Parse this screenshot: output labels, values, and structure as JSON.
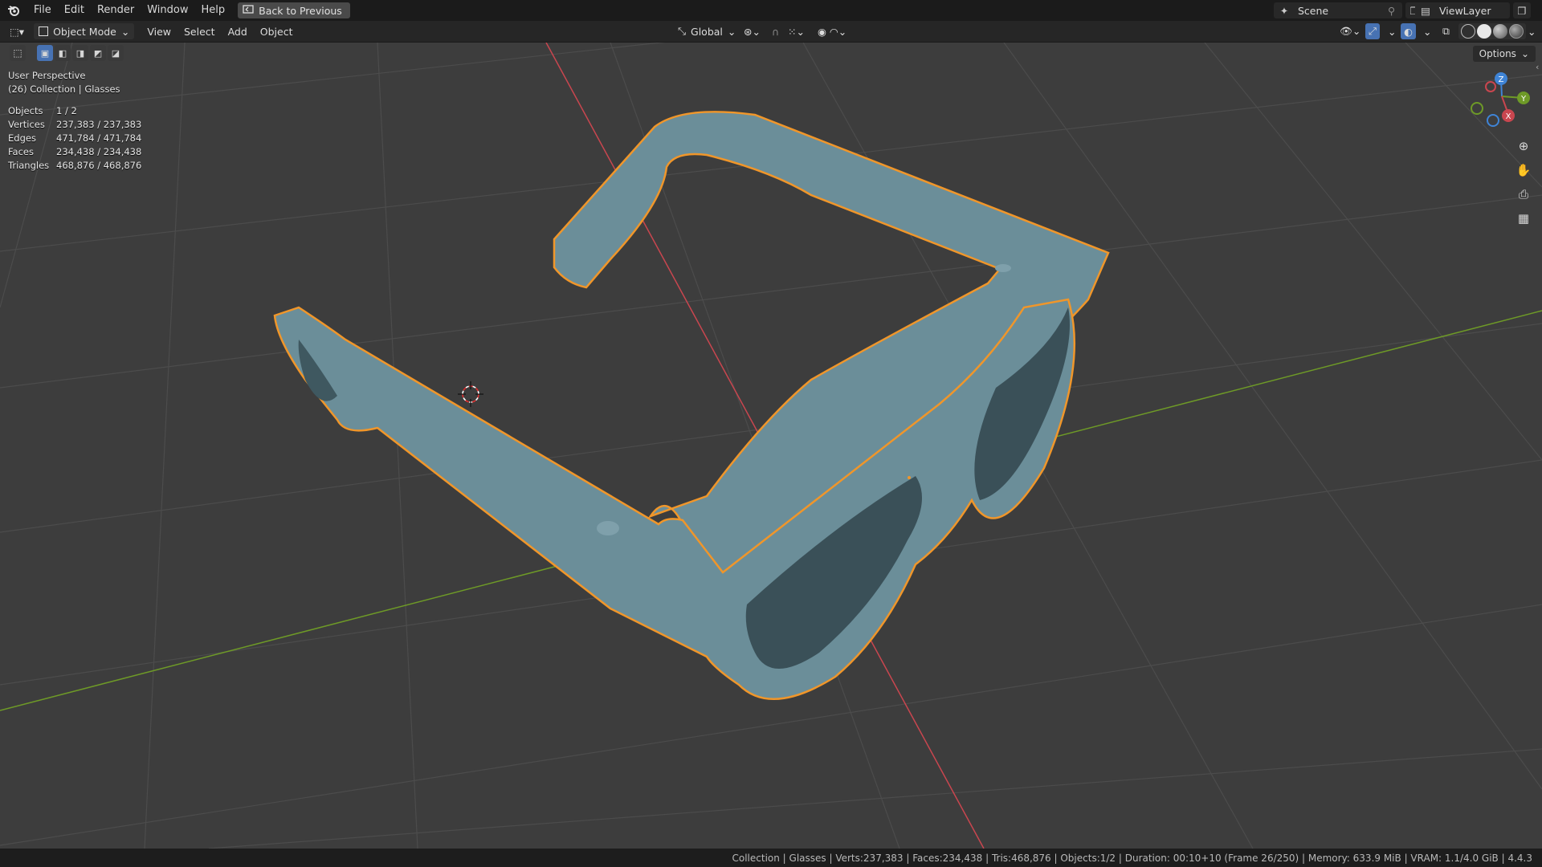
{
  "topbar": {
    "menus": [
      "File",
      "Edit",
      "Render",
      "Window",
      "Help"
    ],
    "back_button": "Back to Previous",
    "scene": "Scene",
    "view_layer": "ViewLayer"
  },
  "header": {
    "mode": "Object Mode",
    "menus": [
      "View",
      "Select",
      "Add",
      "Object"
    ],
    "orientation": "Global",
    "options": "Options"
  },
  "overlay": {
    "view_name": "User Perspective",
    "collection": "(26) Collection | Glasses",
    "stats": [
      {
        "label": "Objects",
        "value": "1 / 2"
      },
      {
        "label": "Vertices",
        "value": "237,383 / 237,383"
      },
      {
        "label": "Edges",
        "value": "471,784 / 471,784"
      },
      {
        "label": "Faces",
        "value": "234,438 / 234,438"
      },
      {
        "label": "Triangles",
        "value": "468,876 / 468,876"
      }
    ]
  },
  "gizmo": {
    "x": "X",
    "y": "Y",
    "z": "Z"
  },
  "statusbar": {
    "text": "Collection | Glasses | Verts:237,383 | Faces:234,438 | Tris:468,876 | Objects:1/2 | Duration: 00:10+10 (Frame 26/250) | Memory: 633.9 MiB | VRAM: 1.1/4.0 GiB | 4.4.3"
  },
  "colors": {
    "viewport_bg": "#3d3d3d",
    "object": "#6b8e99",
    "outline": "#f0962a",
    "x_axis": "#c9464f",
    "y_axis": "#6e9a27",
    "z_axis": "#3f84d6"
  }
}
